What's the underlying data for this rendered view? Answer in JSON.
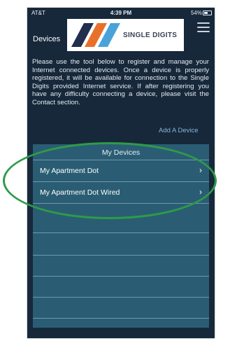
{
  "status_bar": {
    "carrier": "AT&T",
    "time": "4:39 PM",
    "battery": "54%"
  },
  "header": {
    "title": "Devices",
    "logo_text": "SINGLE DIGITS",
    "logo_stripe_colors": [
      "#1f2f4c",
      "#e8702a",
      "#4aa3d8"
    ]
  },
  "intro_text": "Please use the tool below to register and manage your Internet connected devices. Once a device is properly registered, it will be available for connection to the Single Digits provided Internet service. If after registering you have any difficulty connecting a device, please visit the Contact section.",
  "add_device_label": "Add A Device",
  "my_devices": {
    "title": "My Devices",
    "items": [
      {
        "label": "My Apartment Dot",
        "chevron": "›"
      },
      {
        "label": "My Apartment Dot Wired",
        "chevron": "›"
      }
    ]
  },
  "colors": {
    "background": "#17283a",
    "panel": "#2a5d73",
    "link": "#8ab4d8",
    "highlight_ring": "#2e9b4a"
  }
}
